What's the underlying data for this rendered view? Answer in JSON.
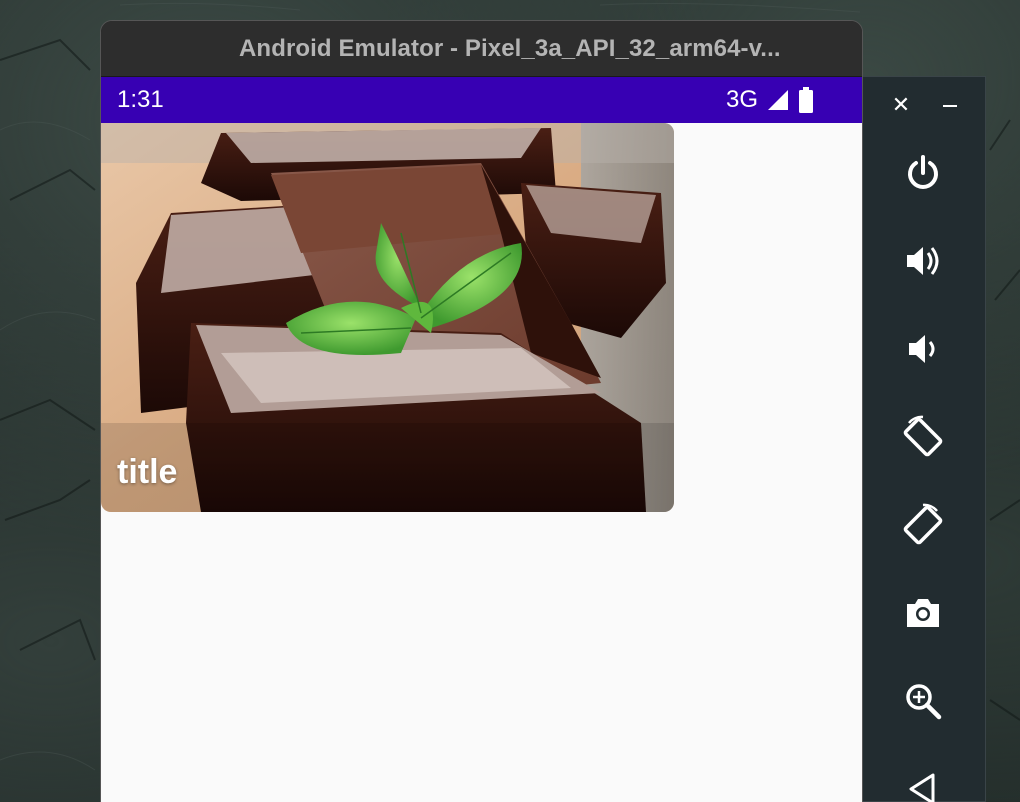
{
  "window": {
    "title": "Android Emulator - Pixel_3a_API_32_arm64-v..."
  },
  "statusbar": {
    "time": "1:31",
    "network": "3G",
    "icons": [
      "signal-icon",
      "battery-icon"
    ],
    "color": "#3700b3"
  },
  "card": {
    "title": "title",
    "image": "chocolate-brownies-with-mint-photo"
  },
  "side_panel": {
    "window_controls": [
      "close-icon",
      "minimize-icon"
    ],
    "controls": [
      {
        "name": "power-icon"
      },
      {
        "name": "volume-up-icon"
      },
      {
        "name": "volume-down-icon"
      },
      {
        "name": "rotate-left-icon"
      },
      {
        "name": "rotate-right-icon"
      },
      {
        "name": "camera-icon"
      },
      {
        "name": "zoom-icon"
      },
      {
        "name": "back-icon"
      }
    ]
  },
  "colors": {
    "accent": "#3700b3",
    "panel": "#222c30",
    "screen_bg": "#fafafa"
  }
}
